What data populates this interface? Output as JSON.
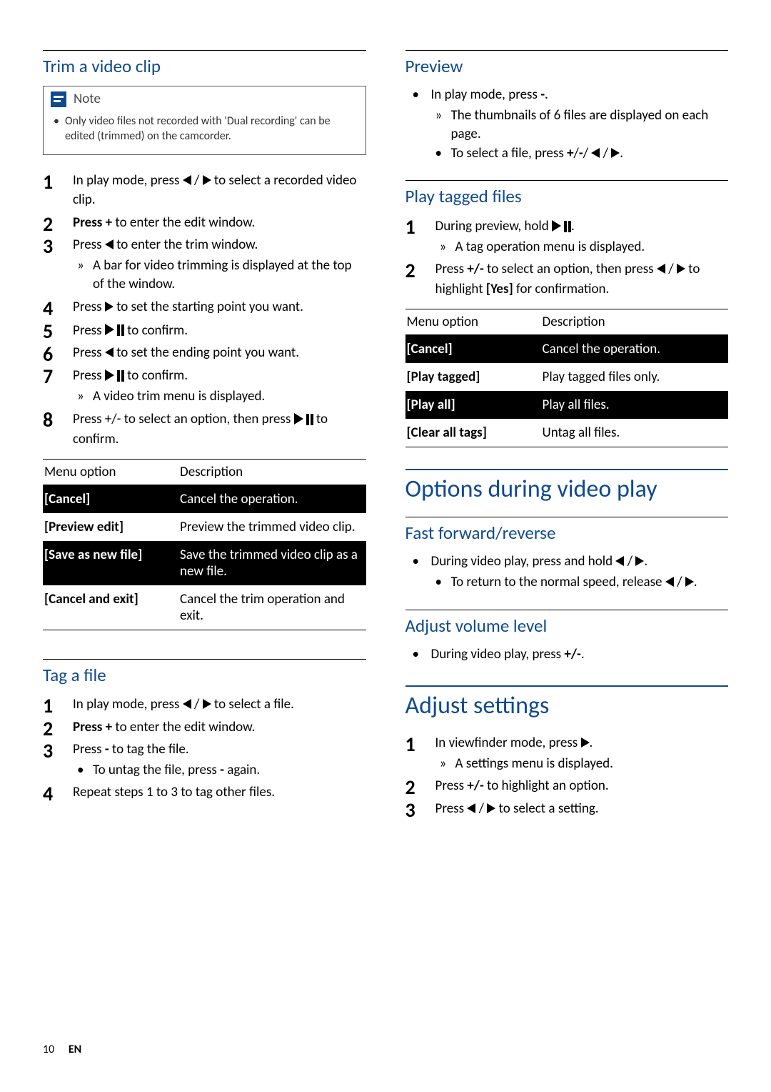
{
  "left": {
    "trim": {
      "title": "Trim a video clip",
      "note_label": "Note",
      "note_text": "Only video files not recorded with 'Dual recording' can be edited (trimmed) on the camcorder.",
      "steps": {
        "s1a": "In play mode, press ",
        "s1b": " / ",
        "s1c": " to select a recorded video clip.",
        "s2": "Press + to enter the edit window.",
        "s3a": "Press ",
        "s3b": " to enter the trim window.",
        "s3r": "A bar for video trimming is displayed at the top of the window.",
        "s4a": "Press ",
        "s4b": " to set the starting point you want.",
        "s5a": "Press ",
        "s5b": " to confirm.",
        "s6a": "Press ",
        "s6b": " to set the ending point you want.",
        "s7a": "Press ",
        "s7b": " to confirm.",
        "s7r": "A video trim menu is displayed.",
        "s8a": "Press +/- to select an option, then press ",
        "s8b": " to confirm."
      },
      "table": {
        "h1": "Menu option",
        "h2": "Description",
        "r1a": "[Cancel]",
        "r1b": "Cancel the operation.",
        "r2a": "[Preview edit]",
        "r2b": "Preview the trimmed video clip.",
        "r3a": "[Save as new file]",
        "r3b": "Save the trimmed video clip as a new file.",
        "r4a": "[Cancel and exit]",
        "r4b": "Cancel the trim operation and exit."
      }
    },
    "tag": {
      "title": "Tag a file",
      "s1a": "In play mode, press ",
      "s1b": " / ",
      "s1c": " to select a file.",
      "s2": "Press + to enter the edit window.",
      "s3": "Press - to tag the file.",
      "s3b": "To untag the file, press - again.",
      "s4": "Repeat steps 1 to 3 to tag other files."
    }
  },
  "right": {
    "preview": {
      "title": "Preview",
      "l1": "In play mode, press -.",
      "l1r": "The thumbnails of 6 files are displayed on each page.",
      "l1b_a": "To select a file, press +/-/ ",
      "l1b_b": " / ",
      "l1b_c": "."
    },
    "playTagged": {
      "title": "Play tagged files",
      "s1a": "During preview, hold ",
      "s1b": ".",
      "s1r": "A tag operation menu is displayed.",
      "s2a": "Press +/- to select an option, then press ",
      "s2b": " / ",
      "s2c": " to highlight [Yes] for confirmation.",
      "table": {
        "h1": "Menu option",
        "h2": "Description",
        "r1a": "[Cancel]",
        "r1b": "Cancel the operation.",
        "r2a": "[Play tagged]",
        "r2b": "Play tagged files only.",
        "r3a": "[Play all]",
        "r3b": "Play all files.",
        "r4a": "[Clear all tags]",
        "r4b": "Untag all files."
      }
    },
    "options": {
      "heading": "Options during video play",
      "ff_title": "Fast forward/reverse",
      "ff_a": "During video play, press and hold ",
      "ff_b": " / ",
      "ff_c": ".",
      "ff_sub_a": "To return to the normal speed, release ",
      "ff_sub_b": " / ",
      "ff_sub_c": ".",
      "vol_title": "Adjust volume level",
      "vol_text": "During video play, press +/-."
    },
    "adjust": {
      "heading": "Adjust settings",
      "s1a": "In viewfinder mode, press ",
      "s1b": ".",
      "s1r": "A settings menu is displayed.",
      "s2": "Press +/- to highlight an option.",
      "s3a": "Press ",
      "s3b": " / ",
      "s3c": " to select a setting."
    }
  },
  "footer": {
    "page": "10",
    "lang": "EN"
  }
}
